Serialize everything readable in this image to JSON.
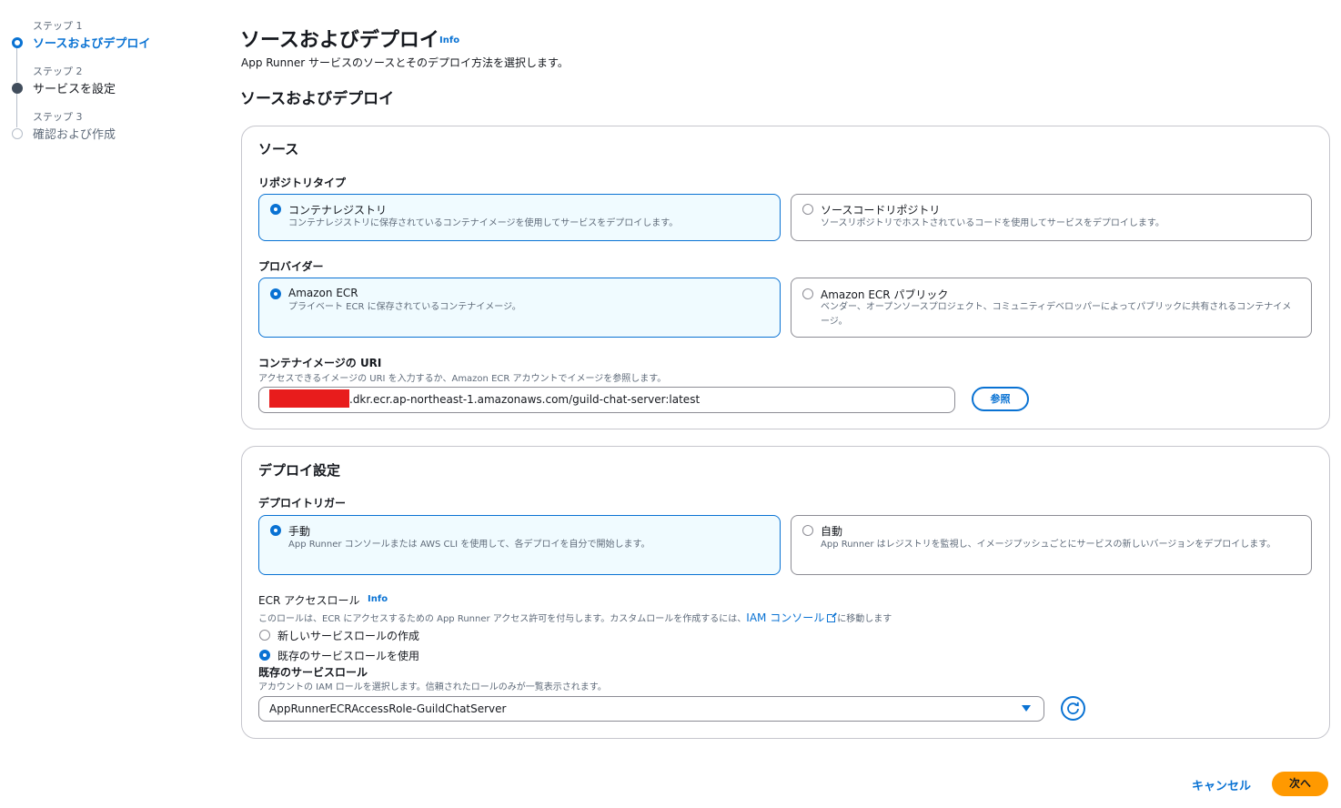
{
  "steps": [
    {
      "sub": "ステップ 1",
      "title": "ソースおよびデプロイ"
    },
    {
      "sub": "ステップ 2",
      "title": "サービスを設定"
    },
    {
      "sub": "ステップ 3",
      "title": "確認および作成"
    }
  ],
  "page": {
    "title": "ソースおよびデプロイ",
    "info": "Info",
    "description": "App Runner サービスのソースとそのデプロイ方法を選択します。",
    "section_title": "ソースおよびデプロイ"
  },
  "source": {
    "header": "ソース",
    "repo_type_label": "リポジトリタイプ",
    "repo_types": [
      {
        "title": "コンテナレジストリ",
        "desc": "コンテナレジストリに保存されているコンテナイメージを使用してサービスをデプロイします。"
      },
      {
        "title": "ソースコードリポジトリ",
        "desc": "ソースリポジトリでホストされているコードを使用してサービスをデプロイします。"
      }
    ],
    "provider_label": "プロバイダー",
    "providers": [
      {
        "title": "Amazon ECR",
        "desc": "プライベート ECR に保存されているコンテナイメージ。"
      },
      {
        "title": "Amazon ECR パブリック",
        "desc": "ベンダー、オープンソースプロジェクト、コミュニティデベロッパーによってパブリックに共有されるコンテナイメージ。"
      }
    ],
    "uri_label": "コンテナイメージの URI",
    "uri_desc": "アクセスできるイメージの URI を入力するか、Amazon ECR アカウントでイメージを参照します。",
    "uri_value": ".dkr.ecr.ap-northeast-1.amazonaws.com/guild-chat-server:latest",
    "browse_button": "参照"
  },
  "deploy": {
    "header": "デプロイ設定",
    "trigger_label": "デプロイトリガー",
    "triggers": [
      {
        "title": "手動",
        "desc": "App Runner コンソールまたは AWS CLI を使用して、各デプロイを自分で開始します。"
      },
      {
        "title": "自動",
        "desc": "App Runner はレジストリを監視し、イメージプッシュごとにサービスの新しいバージョンをデプロイします。"
      }
    ],
    "ecr_role_label": "ECR アクセスロール",
    "ecr_role_info": "Info",
    "ecr_role_desc_pre": "このロールは、ECR にアクセスするための App Runner アクセス許可を付与します。カスタムロールを作成するには、",
    "ecr_role_link": "IAM コンソール",
    "ecr_role_desc_post": "に移動します",
    "role_options": [
      "新しいサービスロールの作成",
      "既存のサービスロールを使用"
    ],
    "existing_role_label": "既存のサービスロール",
    "existing_role_desc": "アカウントの IAM ロールを選択します。信頼されたロールのみが一覧表示されます。",
    "existing_role_value": "AppRunnerECRAccessRole-GuildChatServer"
  },
  "footer": {
    "cancel": "キャンセル",
    "next": "次へ"
  },
  "colors": {
    "accent": "#0972d3",
    "primary_button": "#ff9900",
    "redaction": "#e81c1c"
  }
}
